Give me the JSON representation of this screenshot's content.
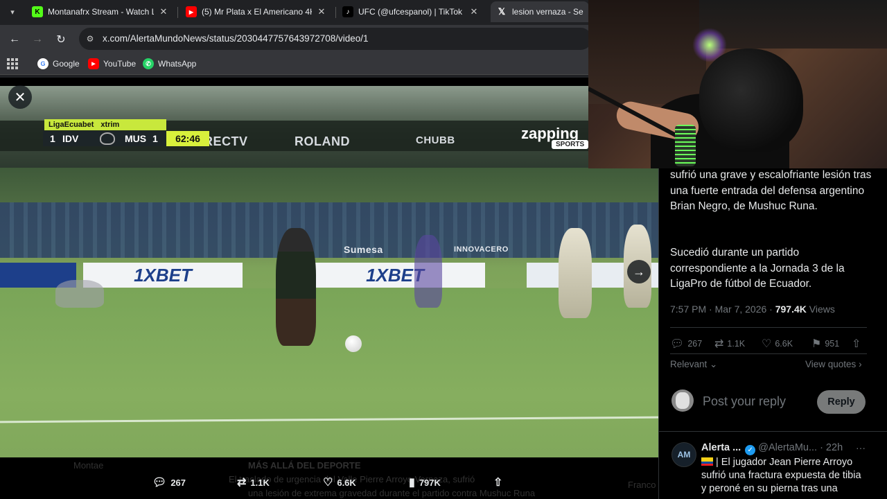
{
  "browser": {
    "tabs": [
      {
        "title": "Montanafrx Stream - Watch Live",
        "favicon": "kick-icon",
        "active": false
      },
      {
        "title": "(5) Mr Plata x El Americano 4K",
        "favicon": "youtube-icon",
        "active": false
      },
      {
        "title": "UFC (@ufcespanol) | TikTok",
        "favicon": "tiktok-icon",
        "active": false
      },
      {
        "title": "lesion vernaza - Search",
        "favicon": "x-icon",
        "active": true
      }
    ],
    "url": "x.com/AlertaMundoNews/status/2030447757643972708/video/1",
    "bookmarks": [
      {
        "label": "Google",
        "icon": "google-icon"
      },
      {
        "label": "YouTube",
        "icon": "youtube-icon"
      },
      {
        "label": "WhatsApp",
        "icon": "whatsapp-icon"
      }
    ]
  },
  "video": {
    "scorebug": {
      "league": "LigaEcuabet",
      "sponsor": "xtrim",
      "home_score": "1",
      "home_team": "IDV",
      "away_team": "MUS",
      "away_score": "1",
      "clock": "62:46"
    },
    "ad_boards": [
      "DIRECTV",
      "ROLAND",
      "CHUBB",
      "1XBET",
      "1XBET",
      "Sumesa",
      "INNOVACERO"
    ],
    "channel_logo": "zapping",
    "channel_logo_sub": "SPORTS",
    "stats": {
      "replies": "267",
      "reposts": "1.1K",
      "likes": "6.6K",
      "views": "797K"
    },
    "ghost_text": {
      "author": "Montae",
      "section": "MÁS ALLÁ DEL DEPORTE",
      "line1": "El traslado de urgencia del Valle Pierre Arroyo Vernaza, sufrió",
      "line2": "una lesión de extrema gravedad durante el partido contra Mushuc Runa",
      "right": "Franco"
    }
  },
  "tweet": {
    "paragraph1": "sufrió una grave y escalofriante lesión tras una fuerte entrada del defensa argentino Brian Negro, de Mushuc Runa.",
    "paragraph2": "Sucedió durante un partido correspondiente a la Jornada 3 de la LigaPro de fútbol de Ecuador.",
    "timestamp": "7:57 PM · Mar 7, 2026 · ",
    "views_count": "797.4K",
    "views_label": " Views",
    "actions": {
      "replies": "267",
      "reposts": "1.1K",
      "likes": "6.6K",
      "bookmarks": "951"
    },
    "sort_label": "Relevant",
    "quotes_label": "View quotes",
    "reply_placeholder": "Post your reply",
    "reply_button": "Reply"
  },
  "reply_tweet": {
    "name": "Alerta ...",
    "handle": "@AlertaMu...",
    "time": "· 22h",
    "body": "| El jugador Jean Pierre Arroyo sufrió una fractura expuesta de tibia y peroné en su pierna tras una"
  },
  "colors": {
    "accent": "#1d9bf0",
    "scorebug_green": "#c8e83c",
    "browser_bg": "#202124"
  }
}
